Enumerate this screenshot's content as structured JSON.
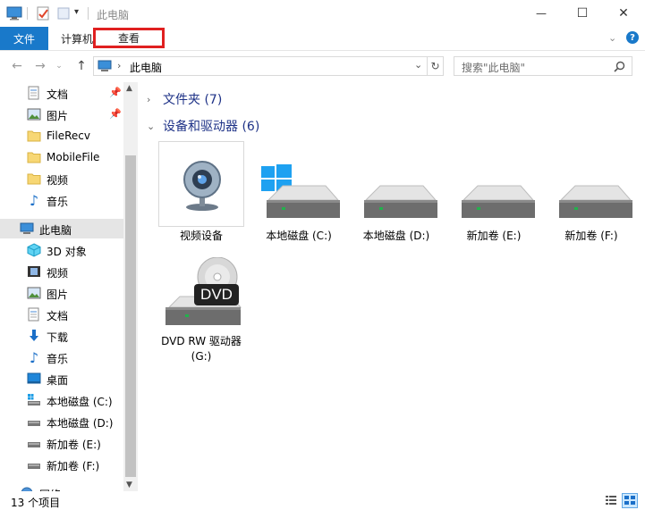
{
  "window": {
    "title": "此电脑",
    "minimize": "—",
    "maximize": "☐",
    "close": "✕"
  },
  "ribbon": {
    "file_tab": "文件",
    "computer_tab": "计算机",
    "view_tab": "查看"
  },
  "address": {
    "path": "此电脑",
    "search_placeholder": "搜索\"此电脑\""
  },
  "nav": {
    "quick": [
      {
        "label": "文档",
        "icon": "documents-icon",
        "pinned": true
      },
      {
        "label": "图片",
        "icon": "pictures-icon",
        "pinned": true
      },
      {
        "label": "FileRecv",
        "icon": "folder-icon",
        "pinned": false
      },
      {
        "label": "MobileFile",
        "icon": "folder-icon",
        "pinned": false
      },
      {
        "label": "视频",
        "icon": "folder-icon",
        "pinned": false
      },
      {
        "label": "音乐",
        "icon": "music-icon",
        "pinned": false
      }
    ],
    "this_pc": "此电脑",
    "pc_items": [
      {
        "label": "3D 对象",
        "icon": "3d-objects-icon"
      },
      {
        "label": "视频",
        "icon": "videos-icon"
      },
      {
        "label": "图片",
        "icon": "pictures-icon"
      },
      {
        "label": "文档",
        "icon": "documents-icon"
      },
      {
        "label": "下载",
        "icon": "downloads-icon"
      },
      {
        "label": "音乐",
        "icon": "music-icon"
      },
      {
        "label": "桌面",
        "icon": "desktop-icon"
      },
      {
        "label": "本地磁盘 (C:)",
        "icon": "system-drive-icon"
      },
      {
        "label": "本地磁盘 (D:)",
        "icon": "drive-icon"
      },
      {
        "label": "新加卷 (E:)",
        "icon": "drive-icon"
      },
      {
        "label": "新加卷 (F:)",
        "icon": "drive-icon"
      }
    ],
    "network": "网络"
  },
  "content": {
    "folders_group": "文件夹 (7)",
    "devices_group": "设备和驱动器 (6)",
    "tiles": [
      {
        "label": "视频设备",
        "icon": "webcam-icon"
      },
      {
        "label": "本地磁盘 (C:)",
        "icon": "system-drive-icon"
      },
      {
        "label": "本地磁盘 (D:)",
        "icon": "drive-icon"
      },
      {
        "label": "新加卷 (E:)",
        "icon": "drive-icon"
      },
      {
        "label": "新加卷 (F:)",
        "icon": "drive-icon"
      }
    ],
    "dvd": {
      "label_line1": "DVD RW 驱动器",
      "label_line2": "(G:)",
      "badge": "DVD",
      "icon": "dvd-drive-icon"
    }
  },
  "status": {
    "count": "13 个项目"
  },
  "colors": {
    "accent": "#1979ca",
    "highlight": "#e02020",
    "selected_bg": "#cce8ff",
    "group_header": "#1e3287",
    "drive_led": "#22b14c"
  }
}
